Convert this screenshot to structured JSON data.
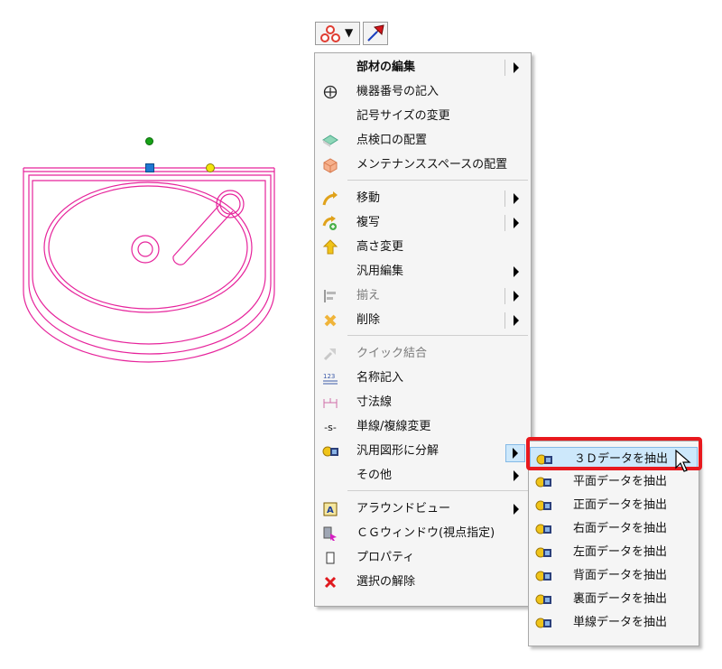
{
  "toolbar": {
    "dropdown_arrow": "▼"
  },
  "menu": {
    "items": [
      {
        "label": "部材の編集",
        "icon": "none",
        "submenu": true,
        "bold": true
      },
      {
        "label": "機器番号の記入",
        "icon": "circle-symbol-icon"
      },
      {
        "label": "記号サイズの変更",
        "icon": "none"
      },
      {
        "label": "点検口の配置",
        "icon": "inspection-port-icon"
      },
      {
        "label": "メンテナンススペースの配置",
        "icon": "maintenance-space-icon"
      },
      {
        "label": "移動",
        "icon": "move-icon",
        "submenu": true
      },
      {
        "label": "複写",
        "icon": "copy-icon",
        "submenu": true
      },
      {
        "label": "高さ変更",
        "icon": "height-change-icon"
      },
      {
        "label": "汎用編集",
        "icon": "none",
        "submenu": true
      },
      {
        "label": "揃え",
        "icon": "align-icon",
        "submenu": true,
        "disabled": true
      },
      {
        "label": "削除",
        "icon": "delete-icon",
        "submenu": true
      },
      {
        "label": "クイック結合",
        "icon": "quick-join-icon",
        "disabled": true
      },
      {
        "label": "名称記入",
        "icon": "name-entry-icon"
      },
      {
        "label": "寸法線",
        "icon": "dimension-line-icon"
      },
      {
        "label": "単線/複線変更",
        "icon": "line-switch-icon"
      },
      {
        "label": "汎用図形に分解",
        "icon": "decompose-icon",
        "submenu": true
      },
      {
        "label": "その他",
        "icon": "none",
        "submenu": true
      },
      {
        "label": "アラウンドビュー",
        "icon": "around-view-icon",
        "submenu": true
      },
      {
        "label": "ＣＧウィンドウ(視点指定)",
        "icon": "cg-window-icon"
      },
      {
        "label": "プロパティ",
        "icon": "property-icon"
      },
      {
        "label": "選択の解除",
        "icon": "deselect-icon"
      }
    ],
    "line_switch_glyph": "-s-"
  },
  "submenu": {
    "items": [
      {
        "label": "３Ｄデータを抽出"
      },
      {
        "label": "平面データを抽出"
      },
      {
        "label": "正面データを抽出"
      },
      {
        "label": "右面データを抽出"
      },
      {
        "label": "左面データを抽出"
      },
      {
        "label": "背面データを抽出"
      },
      {
        "label": "裏面データを抽出"
      },
      {
        "label": "単線データを抽出"
      }
    ]
  },
  "colors": {
    "drawing_line": "#e6239b",
    "handle_green": "#17a117",
    "handle_blue": "#1e78d2",
    "handle_yellow": "#f2e40c",
    "highlight_bg": "#cde8fb",
    "highlight_border": "#84b9e6",
    "callout_red": "#e8191e"
  }
}
